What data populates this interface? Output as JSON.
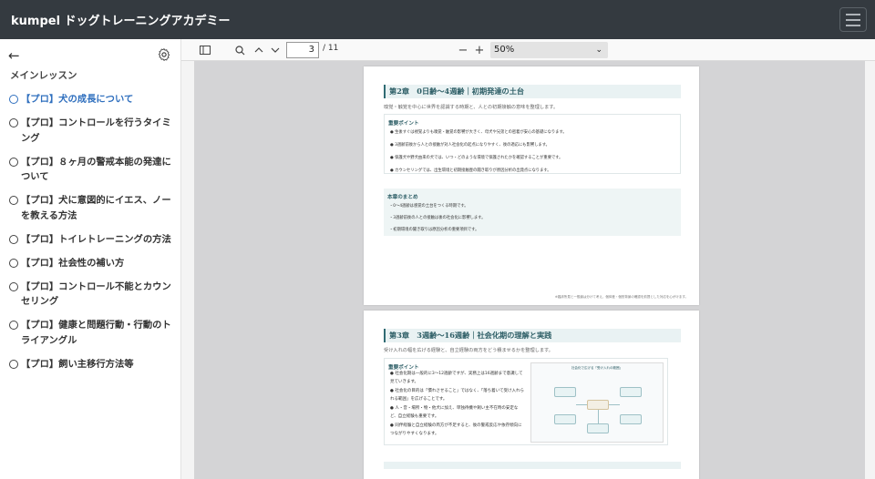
{
  "header": {
    "app_title": "kumpel ドッグトレーニングアカデミー"
  },
  "sidebar": {
    "section_title": "メインレッスン",
    "lessons": [
      {
        "label": "【プロ】犬の成長について",
        "active": true
      },
      {
        "label": "【プロ】コントロールを行うタイミング",
        "active": false
      },
      {
        "label": "【プロ】８ヶ月の警戒本能の発達について",
        "active": false
      },
      {
        "label": "【プロ】犬に意図的にイエス、ノーを教える方法",
        "active": false
      },
      {
        "label": "【プロ】トイレトレーニングの方法",
        "active": false
      },
      {
        "label": "【プロ】社会性の補い方",
        "active": false
      },
      {
        "label": "【プロ】コントロール不能とカウンセリング",
        "active": false
      },
      {
        "label": "【プロ】健康と問題行動・行動のトライアングル",
        "active": false
      },
      {
        "label": "【プロ】飼い主移行方法等",
        "active": false
      }
    ]
  },
  "viewer": {
    "page_current": "3",
    "page_total": "/ 11",
    "zoom_minus": "−",
    "zoom_plus": "+",
    "zoom_level": "50%"
  },
  "document": {
    "page1": {
      "chapter_title": "第2章　0日齢〜4週齢｜初期発達の土台",
      "subtitle": "嗅覚・触覚を中心に世界を認識する時期と、人との初期接触の意味を整理します。",
      "key_points_title": "重要ポイント",
      "key_points": [
        "● 生後すぐは視覚よりも嗅覚・触覚の影響が大きく、母犬や兄弟との密着が安心の基礎になります。",
        "● 3週齢前後から人との接触が対人社会化の起点になりやすく、後の適応にも影響します。",
        "● 保護犬や野犬由来の犬では、いつ・どのような環境で保護されたかを確認することが重要です。",
        "● カウンセリングでは、出生環境と初期接触歴の聞き取りが原因分析の出発点になります。"
      ],
      "summary_title": "本章のまとめ",
      "summary": [
        "・0〜4週齢は感覚の土台をつくる時期です。",
        "・3週齢前後の人との接触は後の社会化に影響します。",
        "・初期環境の聞き取りは原因分析の重要項目です。"
      ],
      "footnote": "※臨床所見と一般論は分けて考え、個体差・個別背景の確認を前提とした対応を心がけます。"
    },
    "page2": {
      "chapter_title": "第3章　3週齢〜16週齢｜社会化期の理解と実践",
      "subtitle": "受け入れの幅を広げる経験と、自立経験の両方をどう積ませるかを整理します。",
      "key_points_title": "重要ポイント",
      "key_points": [
        "● 社会化期は一般的に3〜12週齢ですが、実務上は16週齢まで意識して見ていきます。",
        "● 社会化の目的は「慣れさせること」ではなく、「落ち着いて受け入れられる範囲」を広げることです。",
        "● 人・音・場所・物・他犬に加え、単独待機や飼い主不在時の安定など、自立経験も重要です。",
        "● 同伴経験と自立経験の両方が不足すると、後の警戒反応や依存傾向につながりやすくなります。"
      ],
      "diagram_title": "社会化で広げる「受け入れの範囲」"
    }
  }
}
